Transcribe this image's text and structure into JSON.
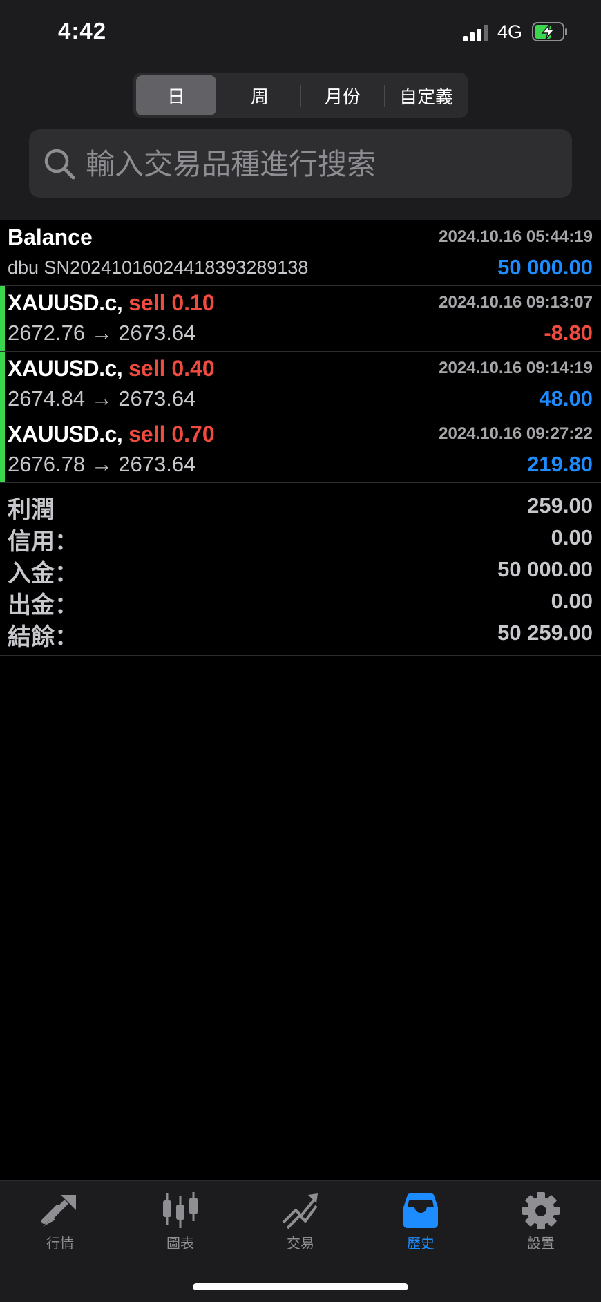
{
  "status_bar": {
    "time": "4:42",
    "network": "4G"
  },
  "period_tabs": {
    "items": [
      "日",
      "周",
      "月份",
      "自定義"
    ],
    "active": "日"
  },
  "search": {
    "placeholder": "輸入交易品種進行搜索"
  },
  "deals": [
    {
      "title": "Balance",
      "time": "2024.10.16 05:44:19",
      "subtitle": "dbu SN20241016024418393289138",
      "amount": "50 000.00",
      "amount_color": "#1c8cff"
    },
    {
      "symbol": "XAUUSD.c,",
      "side": "sell",
      "volume": "0.10",
      "time": "2024.10.16 09:13:07",
      "open_price": "2672.76",
      "close_price": "2673.64",
      "arrow": "→",
      "profit": "-8.80",
      "profit_color": "#ef4b3f"
    },
    {
      "symbol": "XAUUSD.c,",
      "side": "sell",
      "volume": "0.40",
      "time": "2024.10.16 09:14:19",
      "open_price": "2674.84",
      "close_price": "2673.64",
      "arrow": "→",
      "profit": "48.00",
      "profit_color": "#1c8cff"
    },
    {
      "symbol": "XAUUSD.c,",
      "side": "sell",
      "volume": "0.70",
      "time": "2024.10.16 09:27:22",
      "open_price": "2676.78",
      "close_price": "2673.64",
      "arrow": "→",
      "profit": "219.80",
      "profit_color": "#1c8cff"
    }
  ],
  "summary": [
    {
      "label": "利潤",
      "value": "259.00"
    },
    {
      "label": "信用：",
      "value": "0.00"
    },
    {
      "label": "入金：",
      "value": "50 000.00"
    },
    {
      "label": "出金：",
      "value": "0.00"
    },
    {
      "label": "結餘：",
      "value": "50 259.00"
    }
  ],
  "tab_bar": {
    "items": [
      {
        "label": "行情",
        "icon": "quotes-icon"
      },
      {
        "label": "圖表",
        "icon": "chart-icon"
      },
      {
        "label": "交易",
        "icon": "trade-icon"
      },
      {
        "label": "歷史",
        "icon": "history-icon"
      },
      {
        "label": "設置",
        "icon": "settings-icon"
      }
    ],
    "active": "歷史"
  },
  "colors": {
    "positive": "#1c8cff",
    "negative": "#ef4b3f",
    "accent_bar": "#3ad64e",
    "active_tab": "#1c8cff",
    "battery_charge": "#3ad64e"
  }
}
